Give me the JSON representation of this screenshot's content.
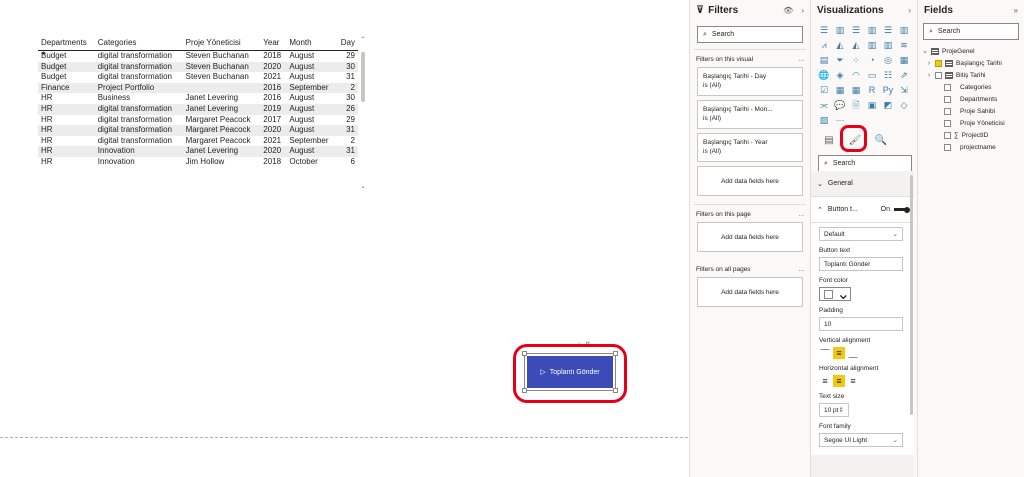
{
  "table": {
    "columns": [
      "Departments",
      "Categories",
      "Proje Yöneticisi",
      "Year",
      "Month",
      "Day"
    ],
    "rows": [
      [
        "Budget",
        "digital transformation",
        "Steven Buchanan",
        "2018",
        "August",
        "29"
      ],
      [
        "Budget",
        "digital transformation",
        "Steven Buchanan",
        "2020",
        "August",
        "30"
      ],
      [
        "Budget",
        "digital transformation",
        "Steven Buchanan",
        "2021",
        "August",
        "31"
      ],
      [
        "Finance",
        "Project Portfolio",
        "",
        "2016",
        "September",
        "2"
      ],
      [
        "HR",
        "Business",
        "Janet Levering",
        "2016",
        "August",
        "30"
      ],
      [
        "HR",
        "digital transformation",
        "Janet Levering",
        "2019",
        "August",
        "26"
      ],
      [
        "HR",
        "digital transformation",
        "Margaret Peacock",
        "2017",
        "August",
        "29"
      ],
      [
        "HR",
        "digital transformation",
        "Margaret Peacock",
        "2020",
        "August",
        "31"
      ],
      [
        "HR",
        "digital transformation",
        "Margaret Peacock",
        "2021",
        "September",
        "2"
      ],
      [
        "HR",
        "Innovation",
        "Janet Levering",
        "2020",
        "August",
        "31"
      ],
      [
        "HR",
        "Innovation",
        "Jim Hollow",
        "2018",
        "October",
        "6"
      ]
    ]
  },
  "button_visual": {
    "label": "Toplantı Gönder",
    "icon": "play-icon"
  },
  "filters": {
    "title": "Filters",
    "search_placeholder": "Search",
    "on_this_visual": "Filters on this visual",
    "cards": [
      {
        "name": "Başlangıç Tarihi - Day",
        "value": "is (All)"
      },
      {
        "name": "Başlangıç Tarihi - Mon...",
        "value": "is (All)"
      },
      {
        "name": "Başlangıç Tarihi - Year",
        "value": "is (All)"
      }
    ],
    "add_fields": "Add data fields here",
    "on_this_page": "Filters on this page",
    "on_all_pages": "Filters on all pages",
    "dots": "..."
  },
  "visualizations": {
    "title": "Visualizations",
    "more": "···",
    "search_placeholder": "Search",
    "general": "General",
    "button_text_header": "Button t...",
    "toggle_label": "On",
    "style_value": "Default",
    "button_text_label": "Button text",
    "button_text_value": "Toplantı Gönder",
    "font_color_label": "Font color",
    "padding_label": "Padding",
    "padding_value": "10",
    "vertical_alignment_label": "Vertical alignment",
    "horizontal_alignment_label": "Horizontal alignment",
    "text_size_label": "Text size",
    "text_size_value": "10  pt",
    "font_family_label": "Font family",
    "font_family_value": "Segoe UI Light"
  },
  "fields": {
    "title": "Fields",
    "search_placeholder": "Search",
    "table_name": "ProjeGenel",
    "items": [
      {
        "label": "Başlangıç Tarihi",
        "checked": true,
        "type": "date-hierarchy"
      },
      {
        "label": "Bitiş Tarihi",
        "checked": false,
        "type": "date-hierarchy"
      },
      {
        "label": "Categories",
        "checked": false,
        "type": "field"
      },
      {
        "label": "Departments",
        "checked": false,
        "type": "field"
      },
      {
        "label": "Proje Sahibi",
        "checked": false,
        "type": "field"
      },
      {
        "label": "Proje Yöneticisi",
        "checked": false,
        "type": "field"
      },
      {
        "label": "ProjectID",
        "checked": false,
        "type": "measure"
      },
      {
        "label": "projectname",
        "checked": false,
        "type": "field"
      }
    ],
    "sigma": "∑"
  },
  "colors": {
    "accent": "#f2c811",
    "button_fill": "#3b4cb8",
    "highlight": "#e3001b"
  }
}
